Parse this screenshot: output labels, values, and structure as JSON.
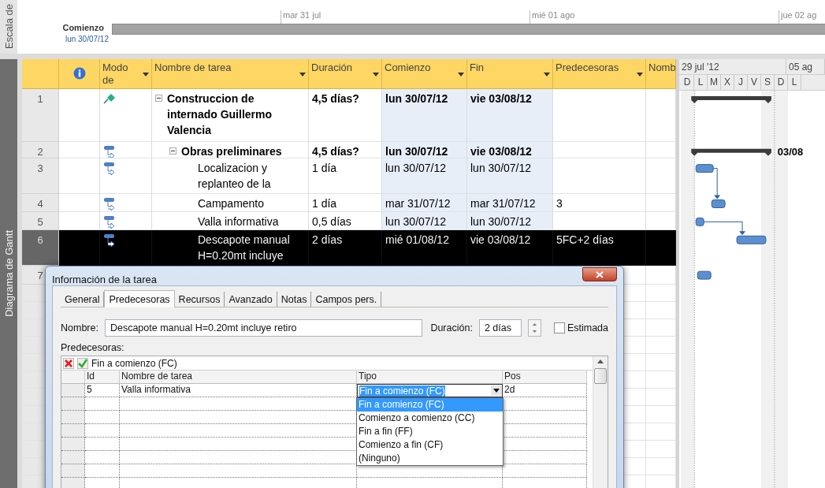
{
  "timeline": {
    "side_label": "Escala de",
    "start_label": "Comienzo",
    "start_date": "lun 30/07/12",
    "date_marks": [
      "mar 31 jul",
      "mié 01 ago",
      "jue 02 ag"
    ]
  },
  "view_label": "Diagrama de Gantt",
  "table": {
    "columns": [
      {
        "label": "Modo de",
        "filter": true
      },
      {
        "label": "Nombre de tarea",
        "filter": true
      },
      {
        "label": "Duración",
        "filter": true
      },
      {
        "label": "Comienzo",
        "filter": true
      },
      {
        "label": "Fin",
        "filter": true
      },
      {
        "label": "Predecesoras",
        "filter": true
      },
      {
        "label": "Nomb",
        "filter": false
      }
    ],
    "rows": [
      {
        "id": "1",
        "manual": true,
        "kind": "summary",
        "expanded": true,
        "selected": false,
        "name": "Construccion de internado Guillermo Valencia",
        "duration": "4,5 días?",
        "start": "lun 30/07/12",
        "end": "vie 03/08/12",
        "children": [
          {
            "id": "2",
            "manual": false,
            "kind": "summary",
            "expanded": true,
            "selected": false,
            "name": "Obras preliminares",
            "duration": "4,5 días?",
            "start": "lun 30/07/12",
            "end": "vie 03/08/12",
            "bar_label": "03/08",
            "children": [
              {
                "id": "3",
                "manual": false,
                "kind": "task",
                "selected": false,
                "name": "Localizacion y replanteo de la",
                "duration": "1 día",
                "start": "lun 30/07/12",
                "end": "lun 30/07/12"
              },
              {
                "id": "4",
                "manual": false,
                "kind": "task",
                "selected": false,
                "name": "Campamento",
                "duration": "1 día",
                "start": "mar 31/07/12",
                "end": "mar 31/07/12",
                "predecessors": "3"
              },
              {
                "id": "5",
                "manual": false,
                "kind": "task",
                "selected": false,
                "name": "Valla informativa",
                "duration": "0,5 días",
                "start": "lun 30/07/12",
                "end": "lun 30/07/12"
              },
              {
                "id": "6",
                "manual": false,
                "kind": "task",
                "selected": true,
                "name": "Descapote manual H=0.20mt incluye",
                "duration": "2 días",
                "start": "mié 01/08/12",
                "end": "vie 03/08/12",
                "predecessors": "5FC+2 días"
              },
              {
                "id": "7",
                "kind": "task",
                "selected": false
              }
            ]
          }
        ]
      }
    ]
  },
  "gantt": {
    "weeks": [
      "29 jul '12",
      "05 ag"
    ],
    "days": [
      "D",
      "L",
      "M",
      "X",
      "J",
      "V",
      "S",
      "D",
      "L"
    ]
  },
  "dialog": {
    "title": "Información de la tarea",
    "tabs": [
      {
        "label": "General",
        "selected": false
      },
      {
        "label": "Predecesoras",
        "selected": true
      },
      {
        "label": "Recursos",
        "selected": false
      },
      {
        "label": "Avanzado",
        "selected": false
      },
      {
        "label": "Notas",
        "selected": false
      },
      {
        "label": "Campos pers.",
        "selected": false
      }
    ],
    "name_label": "Nombre:",
    "name_value": "Descapote manual H=0.20mt incluye retiro",
    "duration_label": "Duración:",
    "duration_value": "2 días",
    "estimated": {
      "label": "Estimada",
      "checked": false
    },
    "predecessors_label": "Predecesoras:",
    "edit_value": "Fin a comienzo (FC)",
    "columns": [
      "Id",
      "Nombre de tarea",
      "Tipo",
      "Pos"
    ],
    "rows": [
      {
        "id": "5",
        "name": "Valla informativa",
        "type": "Fin a comienzo (FC)",
        "lag": "2d"
      }
    ],
    "type_options": [
      {
        "label": "Fin a comienzo (FC)",
        "selected": true
      },
      {
        "label": "Comienzo a comienzo (CC)",
        "selected": false
      },
      {
        "label": "Fin a fin (FF)",
        "selected": false
      },
      {
        "label": "Comienzo a fin (CF)",
        "selected": false
      },
      {
        "label": "(Ninguno)",
        "selected": false
      }
    ]
  }
}
